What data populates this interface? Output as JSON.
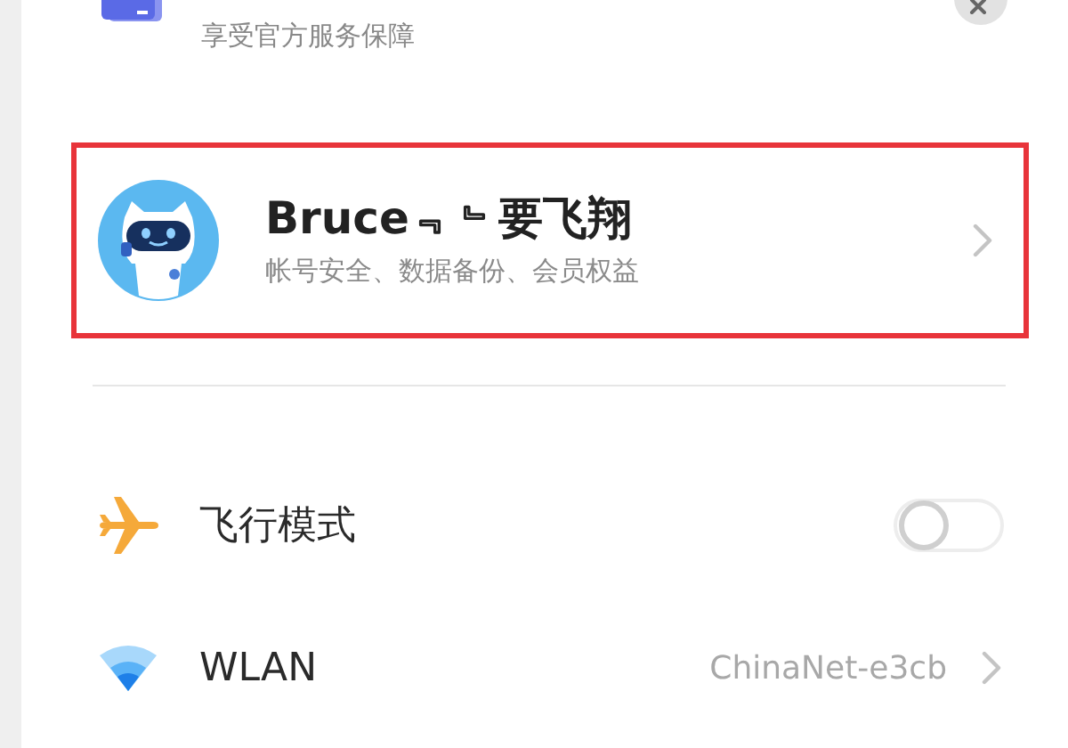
{
  "promo": {
    "subtitle": "享受官方服务保障"
  },
  "account": {
    "name": "Bruce﹃﹄要飞翔",
    "subtitle": "帐号安全、数据备份、会员权益",
    "highlighted": true
  },
  "settings": [
    {
      "kind": "toggle",
      "label": "飞行模式",
      "on": false
    },
    {
      "kind": "link",
      "label": "WLAN",
      "value": "ChinaNet-e3cb"
    }
  ]
}
